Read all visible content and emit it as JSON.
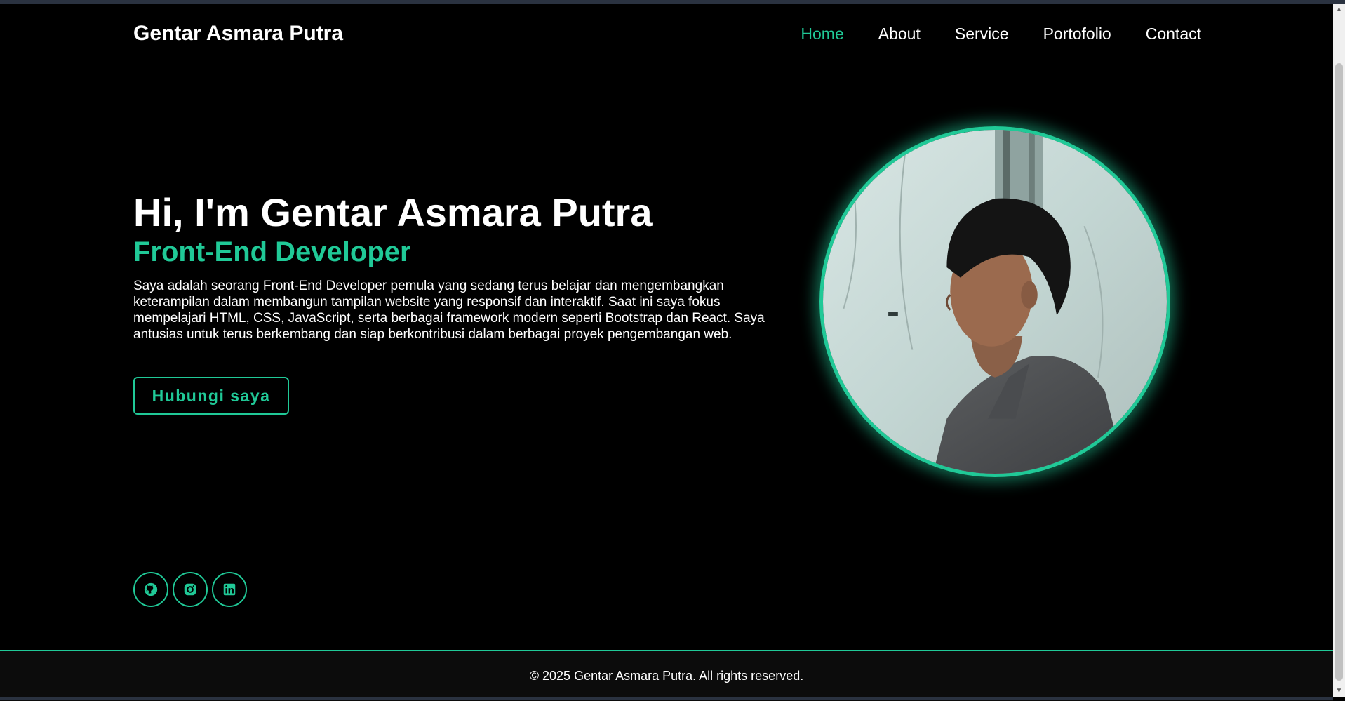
{
  "header": {
    "brand": "Gentar Asmara Putra",
    "nav": [
      {
        "label": "Home",
        "active": true
      },
      {
        "label": "About",
        "active": false
      },
      {
        "label": "Service",
        "active": false
      },
      {
        "label": "Portofolio",
        "active": false
      },
      {
        "label": "Contact",
        "active": false
      }
    ]
  },
  "hero": {
    "title": "Hi, I'm Gentar Asmara Putra",
    "subtitle": "Front-End Developer",
    "description": "Saya adalah seorang Front-End Developer pemula yang sedang terus belajar dan mengembangkan keterampilan dalam membangun tampilan website yang responsif dan interaktif. Saat ini saya fokus mempelajari HTML, CSS, JavaScript, serta berbagai framework modern seperti Bootstrap dan React. Saya antusias untuk terus berkembang dan siap berkontribusi dalam berbagai proyek pengembangan web.",
    "cta_label": "Hubungi saya",
    "photo_icon": "profile-photo"
  },
  "socials": [
    {
      "icon": "github-icon"
    },
    {
      "icon": "instagram-icon"
    },
    {
      "icon": "linkedin-icon"
    }
  ],
  "footer": {
    "text": "© 2025 Gentar Asmara Putra. All rights reserved."
  },
  "colors": {
    "accent": "#20c997",
    "background": "#000000",
    "footer_bg": "#0c0c0c"
  }
}
